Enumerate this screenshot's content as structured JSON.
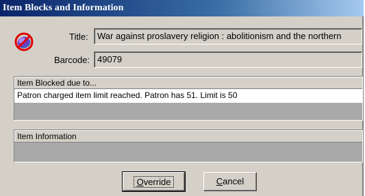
{
  "window": {
    "title": "Item Blocks and Information"
  },
  "icons": {
    "blocked": "blocked-item-icon",
    "colors": {
      "ring": "#e00000",
      "disc": "#7040c0",
      "shadow": "#4060c0"
    }
  },
  "fields": {
    "title_label": "Title:",
    "title_value": "War against proslavery religion : abolitionism and the northern",
    "barcode_label": "Barcode:",
    "barcode_value": "49079"
  },
  "blocked_panel": {
    "header": "Item Blocked due to...",
    "rows": [
      "Patron charged item limit reached.  Patron has 51. Limit is 50"
    ]
  },
  "info_panel": {
    "header": "Item Information"
  },
  "buttons": {
    "override_first": "O",
    "override_rest": "verride",
    "cancel_first": "C",
    "cancel_rest": "ancel"
  }
}
